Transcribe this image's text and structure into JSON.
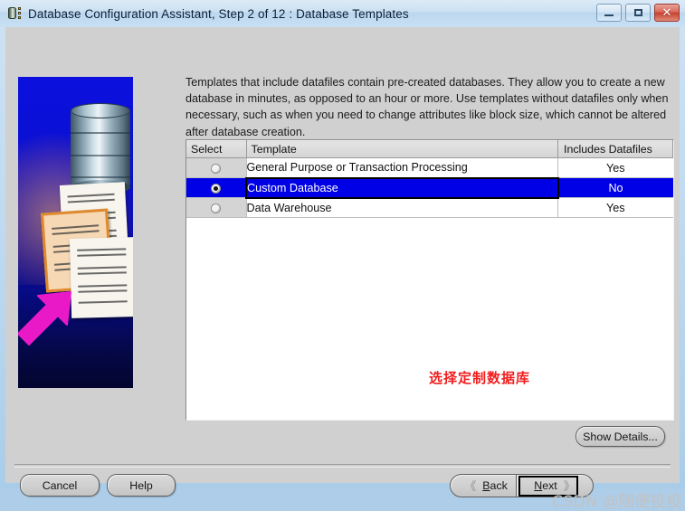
{
  "window": {
    "title": "Database Configuration Assistant, Step 2 of 12 : Database Templates",
    "icon": "database-icon",
    "controls": {
      "minimize": "minimize-icon",
      "maximize": "maximize-icon",
      "close": "✕"
    }
  },
  "main": {
    "description": "Templates that include datafiles contain pre-created databases. They allow you to create a new database in minutes, as opposed to an hour or more. Use templates without datafiles only when necessary, such as when you need to change attributes like block size, which cannot be altered after database creation.",
    "annotation": "选择定制数据库",
    "annotation_color": "#f11d1d"
  },
  "table": {
    "columns": [
      "Select",
      "Template",
      "Includes Datafiles"
    ],
    "rows": [
      {
        "selected": false,
        "template": "General Purpose or Transaction Processing",
        "includes_datafiles": "Yes"
      },
      {
        "selected": true,
        "template": "Custom Database",
        "includes_datafiles": "No"
      },
      {
        "selected": false,
        "template": "Data Warehouse",
        "includes_datafiles": "Yes"
      }
    ],
    "selection_color": "#0000e6"
  },
  "buttons": {
    "show_details": "Show Details...",
    "cancel": "Cancel",
    "help": "Help",
    "back": "Back",
    "back_chevron": "《",
    "next": "Next",
    "next_chevron": "》"
  },
  "watermark": "CSDN @随便投投"
}
